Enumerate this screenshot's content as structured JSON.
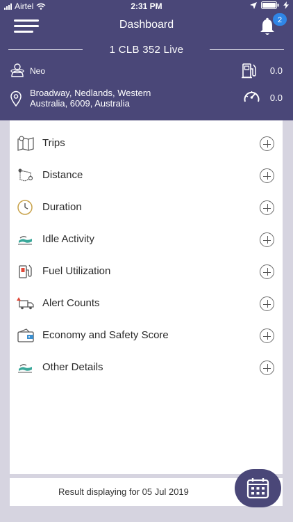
{
  "status_bar": {
    "carrier": "Airtel",
    "time": "2:31 PM"
  },
  "header": {
    "title": "Dashboard",
    "notification_count": "2",
    "vehicle": "1 CLB 352 Live",
    "driver_name": "Neo",
    "fuel_value": "0.0",
    "address_line1": "Broadway, Nedlands, Western",
    "address_line2": "Australia, 6009, Australia",
    "speed_value": "0.0"
  },
  "menu_items": [
    {
      "label": "Trips",
      "icon": "map-icon"
    },
    {
      "label": "Distance",
      "icon": "route-icon"
    },
    {
      "label": "Duration",
      "icon": "clock-icon"
    },
    {
      "label": "Idle Activity",
      "icon": "idle-icon"
    },
    {
      "label": "Fuel Utilization",
      "icon": "fuel-pump-icon"
    },
    {
      "label": "Alert Counts",
      "icon": "truck-alert-icon"
    },
    {
      "label": "Economy and Safety Score",
      "icon": "wallet-icon"
    },
    {
      "label": "Other Details",
      "icon": "details-icon"
    }
  ],
  "footer": {
    "text": "Result displaying for 05 Jul 2019"
  },
  "colors": {
    "header_bg": "#4a4778",
    "badge": "#2f86e8",
    "page_bg": "#d6d4e0"
  }
}
